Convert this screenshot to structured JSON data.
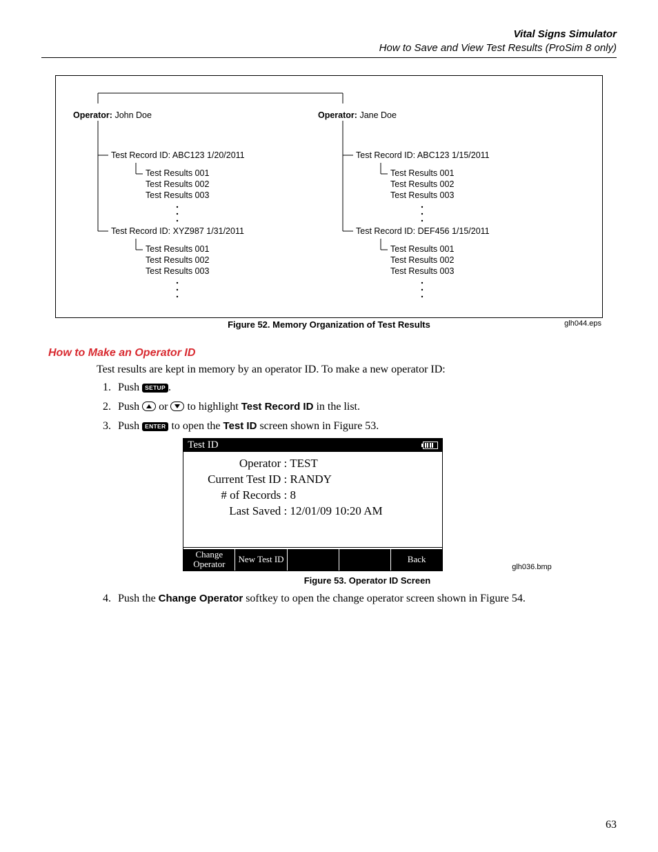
{
  "header": {
    "title": "Vital Signs Simulator",
    "subtitle": "How to Save and View Test Results (ProSim 8 only)"
  },
  "fig52": {
    "caption": "Figure 52. Memory Organization of Test Results",
    "eps": "glh044.eps",
    "op1": {
      "label": "Operator:",
      "name": "John Doe",
      "rec1": {
        "id": "Test Record ID: ABC123 1/20/2011",
        "r1": "Test Results 001",
        "r2": "Test Results 002",
        "r3": "Test Results 003"
      },
      "rec2": {
        "id": "Test Record ID: XYZ987 1/31/2011",
        "r1": "Test Results 001",
        "r2": "Test Results 002",
        "r3": "Test Results 003"
      }
    },
    "op2": {
      "label": "Operator:",
      "name": "Jane Doe",
      "rec1": {
        "id": "Test Record ID: ABC123 1/15/2011",
        "r1": "Test Results 001",
        "r2": "Test Results 002",
        "r3": "Test Results 003"
      },
      "rec2": {
        "id": "Test Record ID: DEF456 1/15/2011",
        "r1": "Test Results 001",
        "r2": "Test Results 002",
        "r3": "Test Results 003"
      }
    }
  },
  "section": {
    "title": "How to Make an Operator ID",
    "intro": "Test results are kept in memory by an operator ID. To make a new operator ID:",
    "step1_a": "Push ",
    "step1_b": ".",
    "key_setup": "SETUP",
    "step2_a": "Push ",
    "step2_b": " or ",
    "step2_c": " to highlight ",
    "step2_bold": "Test Record ID",
    "step2_d": " in the list.",
    "step3_a": "Push ",
    "key_enter": "ENTER",
    "step3_b": " to open the ",
    "step3_bold": "Test ID",
    "step3_c": " screen shown in Figure 53.",
    "step4_a": "Push the ",
    "step4_bold": "Change Operator",
    "step4_b": " softkey to open the change operator screen shown in Figure 54."
  },
  "fig53": {
    "caption": "Figure 53. Operator ID Screen",
    "eps": "glh036.bmp",
    "title": "Test ID",
    "operator_lbl": "Operator :",
    "operator_val": "TEST",
    "testid_lbl": "Current Test ID :",
    "testid_val": "RANDY",
    "records_lbl": "# of Records :",
    "records_val": "8",
    "saved_lbl": "Last Saved :",
    "saved_val": "12/01/09 10:20 AM",
    "sk1": "Change Operator",
    "sk2": "New Test ID",
    "sk5": "Back"
  },
  "page_number": "63"
}
